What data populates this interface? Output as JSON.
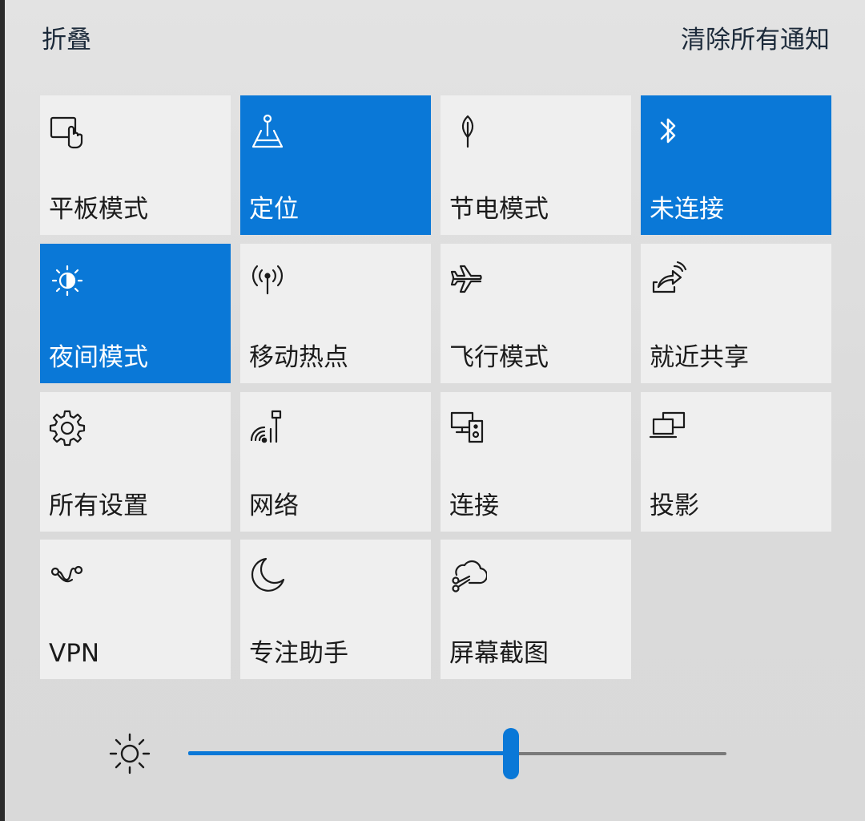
{
  "header": {
    "collapse_label": "折叠",
    "clear_all_label": "清除所有通知"
  },
  "tiles": [
    {
      "label": "平板模式",
      "icon": "tablet-mode-icon",
      "active": false
    },
    {
      "label": "定位",
      "icon": "location-icon",
      "active": true
    },
    {
      "label": "节电模式",
      "icon": "battery-saver-icon",
      "active": false
    },
    {
      "label": "未连接",
      "icon": "bluetooth-icon",
      "active": true
    },
    {
      "label": "夜间模式",
      "icon": "night-light-icon",
      "active": true
    },
    {
      "label": "移动热点",
      "icon": "mobile-hotspot-icon",
      "active": false
    },
    {
      "label": "飞行模式",
      "icon": "airplane-icon",
      "active": false
    },
    {
      "label": "就近共享",
      "icon": "nearby-share-icon",
      "active": false
    },
    {
      "label": "所有设置",
      "icon": "gear-icon",
      "active": false
    },
    {
      "label": "网络",
      "icon": "network-icon",
      "active": false
    },
    {
      "label": "连接",
      "icon": "connect-icon",
      "active": false
    },
    {
      "label": "投影",
      "icon": "project-icon",
      "active": false
    },
    {
      "label": "VPN",
      "icon": "vpn-icon",
      "active": false
    },
    {
      "label": "专注助手",
      "icon": "moon-icon",
      "active": false
    },
    {
      "label": "屏幕截图",
      "icon": "screen-snip-icon",
      "active": false
    }
  ],
  "brightness": {
    "icon": "sun-icon",
    "level": 0.6
  },
  "colors": {
    "accent": "#0a78d7",
    "tile_inactive": "#efefef",
    "panel_background": "#dedede"
  }
}
